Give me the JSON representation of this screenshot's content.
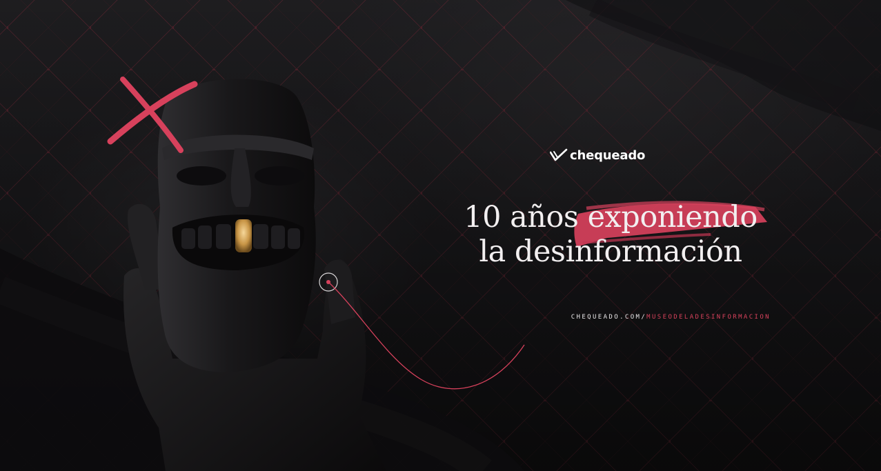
{
  "brand": {
    "logo_text": "chequeado",
    "accent_color": "#d7415c",
    "icon": "checkmark-logo-icon"
  },
  "headline": {
    "line1_prefix": "10 años ",
    "line1_highlight": "exponiendo",
    "line2": "la desinformación"
  },
  "url": {
    "domain": "CHEQUEADO.COM/",
    "path": "MUSEODELADESINFORMACION"
  },
  "background": {
    "color": "#1c1b1d",
    "grid_color": "#7a2e3c"
  }
}
